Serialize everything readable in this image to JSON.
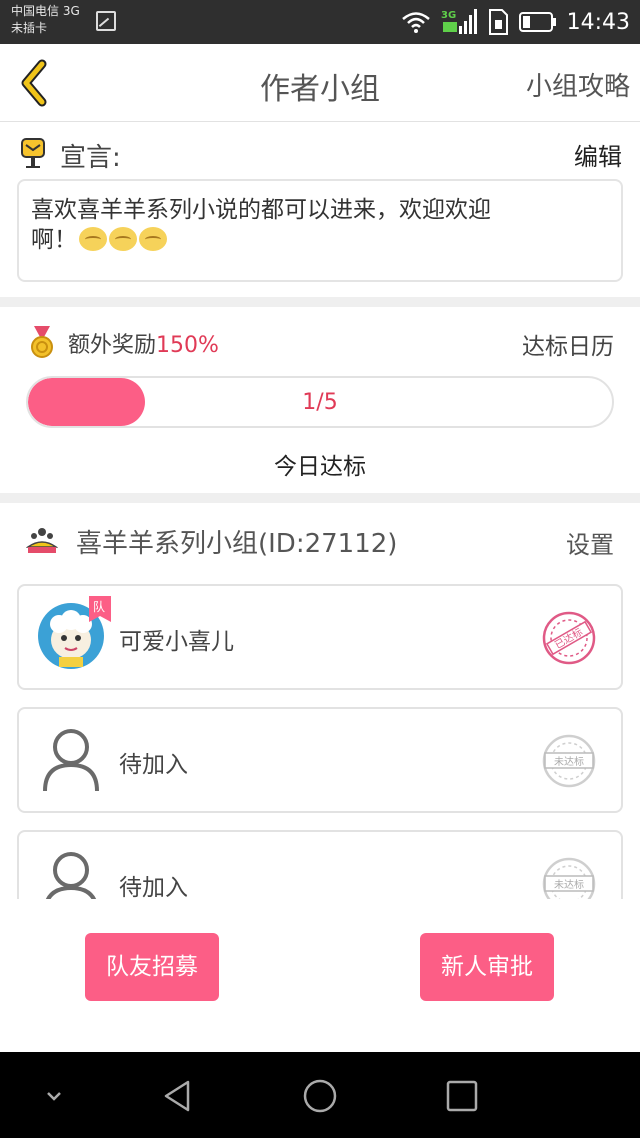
{
  "status_bar": {
    "carrier_line1": "中国电信 3G",
    "carrier_line2": "未插卡",
    "time": "14:43",
    "icons": [
      "image-icon",
      "wifi-icon",
      "signal-3g-icon",
      "sim-icon",
      "battery-icon"
    ]
  },
  "header": {
    "title": "作者小组",
    "right_link": "小组攻略",
    "back_icon": "chevron-left-icon"
  },
  "declaration": {
    "label": "宣言:",
    "edit": "编辑",
    "text_line1": "喜欢喜羊羊系列小说的都可以进来，欢迎欢迎",
    "text_line2": "啊！",
    "emoji_count": 3
  },
  "reward": {
    "label": "额外奖励",
    "percent": "150%",
    "calendar": "达标日历",
    "progress_text": "1/5",
    "progress_value": 0.2,
    "today_status": "今日达标"
  },
  "group": {
    "title": "喜羊羊系列小组(ID:27112)",
    "settings": "设置",
    "members": [
      {
        "name": "可爱小喜儿",
        "badge": "队",
        "stamp": "已达标"
      },
      {
        "name": "待加入",
        "stamp": "未达标"
      },
      {
        "name": "待加入",
        "stamp": "未达标"
      }
    ]
  },
  "actions": {
    "recruit": "队友招募",
    "approve": "新人审批"
  },
  "colors": {
    "accent": "#fc5e86",
    "accent_text": "#e03a56",
    "back_arrow": "#f0c419"
  },
  "navbar": {
    "icons": [
      "chevron-down-icon",
      "back-triangle-icon",
      "home-circle-icon",
      "recent-square-icon"
    ]
  }
}
